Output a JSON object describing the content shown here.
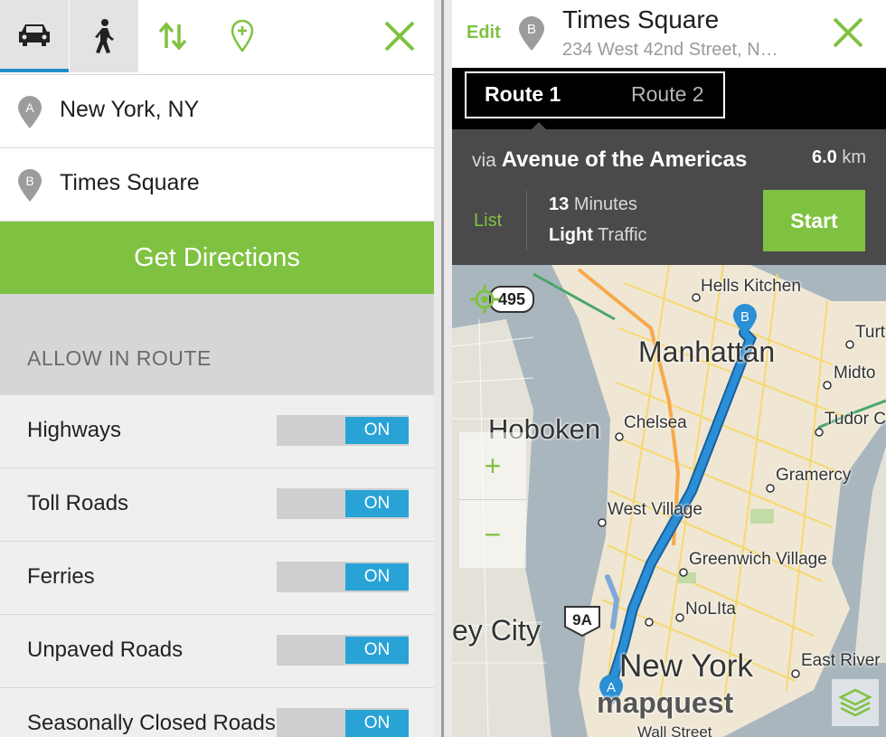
{
  "left": {
    "modes": {
      "car": "car-icon",
      "walk": "walking-icon",
      "swap": "swap-icon",
      "add_stop": "add-stop-icon",
      "close": "close-icon"
    },
    "origin": {
      "marker": "A",
      "text": "New York, NY"
    },
    "destination": {
      "marker": "B",
      "text": "Times Square"
    },
    "get_directions_label": "Get Directions",
    "allow_header": "ALLOW IN ROUTE",
    "options": [
      {
        "label": "Highways",
        "state": "ON"
      },
      {
        "label": "Toll Roads",
        "state": "ON"
      },
      {
        "label": "Ferries",
        "state": "ON"
      },
      {
        "label": "Unpaved Roads",
        "state": "ON"
      },
      {
        "label": "Seasonally Closed Roads",
        "state": "ON"
      }
    ]
  },
  "right": {
    "edit_label": "Edit",
    "dest_marker": "B",
    "dest_title": "Times Square",
    "dest_subtitle": "234 West 42nd Street, N…",
    "routes": [
      "Route 1",
      "Route 2"
    ],
    "selected_route": "Route 1",
    "via_prefix": "via",
    "via_road": "Avenue of the Americas",
    "distance_value": "6.0",
    "distance_unit": "km",
    "list_label": "List",
    "time_value": "13",
    "time_unit": "Minutes",
    "traffic_level": "Light",
    "traffic_word": "Traffic",
    "start_label": "Start",
    "map": {
      "zoom_in": "+",
      "zoom_out": "−",
      "highway_shield_1": "495",
      "highway_shield_2": "9A",
      "marker_a": "A",
      "marker_b": "B",
      "labels": {
        "hells_kitchen": "Hells Kitchen",
        "manhattan": "Manhattan",
        "turt": "Turt",
        "midto": "Midto",
        "hoboken": "Hoboken",
        "chelsea": "Chelsea",
        "tudor": "Tudor C",
        "gramercy": "Gramercy",
        "west_village": "West Village",
        "greenwich": "Greenwich Village",
        "nolita": "NoLIta",
        "jersey_city": "ey City",
        "new_york": "New York",
        "east_river": "East River",
        "mapquest": "mapquest",
        "wall_street": "Wall Street"
      },
      "colors": {
        "water": "#a9b6bd",
        "land": "#efe7d4",
        "route": "#2a8fd6",
        "accent": "#7fc241"
      }
    }
  }
}
